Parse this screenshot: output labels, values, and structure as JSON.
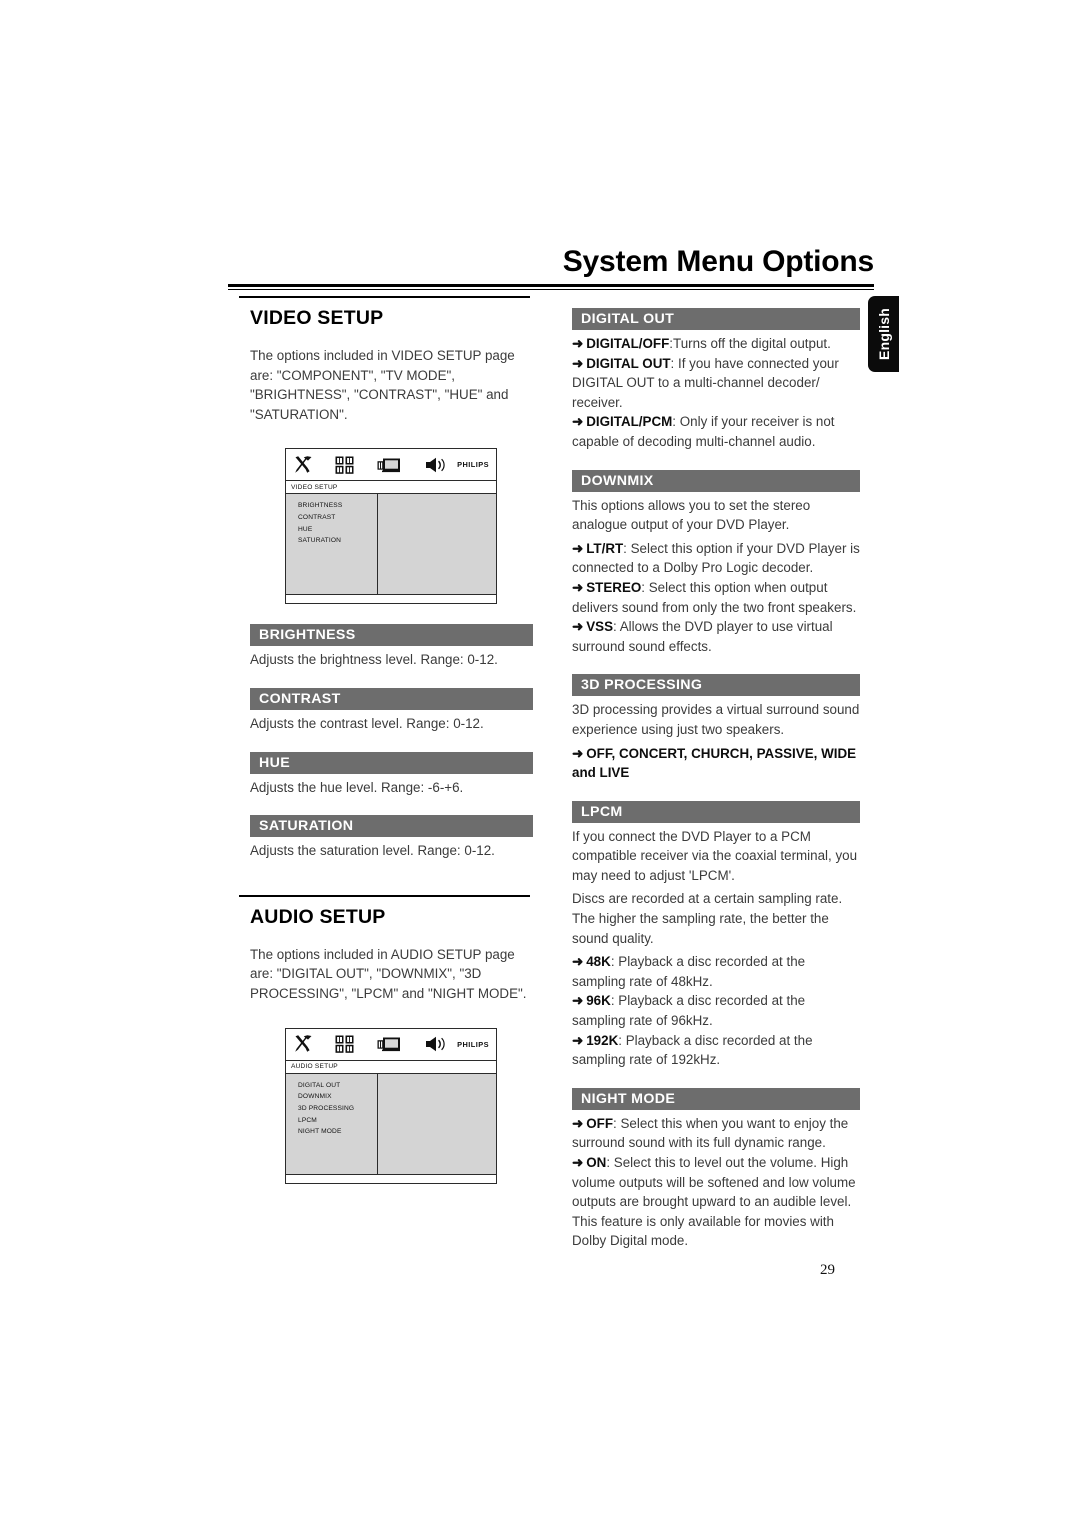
{
  "header": {
    "title": "System Menu Options",
    "language_tab": "English",
    "page_number": "29"
  },
  "left_column": {
    "video_setup": {
      "title": "VIDEO SETUP",
      "intro": "The options included in VIDEO SETUP page are: \"COMPONENT\", \"TV MODE\", \"BRIGHTNESS\", \"CONTRAST\", \"HUE\" and \"SATURATION\".",
      "osd": {
        "menu_title": "VIDEO SETUP",
        "brand": "PHILIPS",
        "icons": [
          "tools-icon",
          "grid-icon",
          "tv-icon",
          "speaker-icon"
        ],
        "items": [
          "BRIGHTNESS",
          "CONTRAST",
          "HUE",
          "SATURATION"
        ]
      },
      "sections": [
        {
          "heading": "BRIGHTNESS",
          "body": "Adjusts the brightness level. Range: 0-12."
        },
        {
          "heading": "CONTRAST",
          "body": "Adjusts the contrast level. Range: 0-12."
        },
        {
          "heading": "HUE",
          "body": "Adjusts the hue level. Range: -6-+6."
        },
        {
          "heading": "SATURATION",
          "body": "Adjusts the saturation level. Range: 0-12."
        }
      ]
    },
    "audio_setup": {
      "title": "AUDIO SETUP",
      "intro": "The options included in AUDIO SETUP page are: \"DIGITAL OUT\", \"DOWNMIX\", \"3D PROCESSING\", \"LPCM\" and \"NIGHT MODE\".",
      "osd": {
        "menu_title": "AUDIO SETUP",
        "brand": "PHILIPS",
        "icons": [
          "tools-icon",
          "grid-icon",
          "tv-icon",
          "speaker-icon"
        ],
        "items": [
          "DIGITAL OUT",
          "DOWNMIX",
          "3D PROCESSING",
          "LPCM",
          "NIGHT MODE"
        ]
      }
    }
  },
  "right_column": {
    "digital_out": {
      "heading": "DIGITAL OUT",
      "bullets": [
        {
          "term": "DIGITAL/OFF",
          "sep": ":",
          "text": "Turns off the digital output."
        },
        {
          "term": "DIGITAL OUT",
          "sep": ":",
          "text": " If you have connected your DIGITAL OUT to a multi-channel decoder/ receiver."
        },
        {
          "term": "DIGITAL/PCM",
          "sep": ":",
          "text": " Only if your receiver is not capable of decoding multi-channel audio."
        }
      ]
    },
    "downmix": {
      "heading": "DOWNMIX",
      "intro": "This options allows you to set the stereo analogue output of your DVD Player.",
      "bullets": [
        {
          "term": "LT/RT",
          "sep": ":",
          "text": " Select this option if your DVD Player is connected to a Dolby Pro Logic decoder."
        },
        {
          "term": "STEREO",
          "sep": ":",
          "text": " Select this option when output delivers sound from only the two front speakers."
        },
        {
          "term": "VSS",
          "sep": ":",
          "text": " Allows the DVD player to use virtual surround sound effects."
        }
      ]
    },
    "processing_3d": {
      "heading": "3D PROCESSING",
      "intro": "3D processing provides a virtual surround sound experience using just two speakers.",
      "options_line": "OFF, CONCERT, CHURCH, PASSIVE, WIDE and LIVE"
    },
    "lpcm": {
      "heading": "LPCM",
      "intro": "If you connect the DVD Player to a PCM compatible receiver via the coaxial terminal, you may need to adjust 'LPCM'.",
      "intro2": "Discs are recorded at a certain sampling rate. The higher the sampling rate, the better the sound quality.",
      "bullets": [
        {
          "term": "48K",
          "sep": ":",
          "text": " Playback a disc recorded at the sampling rate of 48kHz."
        },
        {
          "term": "96K",
          "sep": ":",
          "text": " Playback a disc recorded at the sampling rate of 96kHz."
        },
        {
          "term": "192K",
          "sep": ":",
          "text": " Playback a disc recorded at the sampling rate of 192kHz."
        }
      ]
    },
    "night_mode": {
      "heading": "NIGHT MODE",
      "bullets": [
        {
          "term": "OFF",
          "sep": ":",
          "text": " Select this when you want to enjoy the surround sound with its full dynamic range."
        },
        {
          "term": "ON",
          "sep": ":",
          "text": " Select this to level out the volume. High volume outputs will be softened and low volume outputs are brought upward to an audible level. This feature is only available for movies with Dolby Digital mode."
        }
      ]
    }
  },
  "colors": {
    "bar_gray": "#6d6d6d",
    "osd_body": "#d4d4d4",
    "text": "#3b3b3b"
  }
}
